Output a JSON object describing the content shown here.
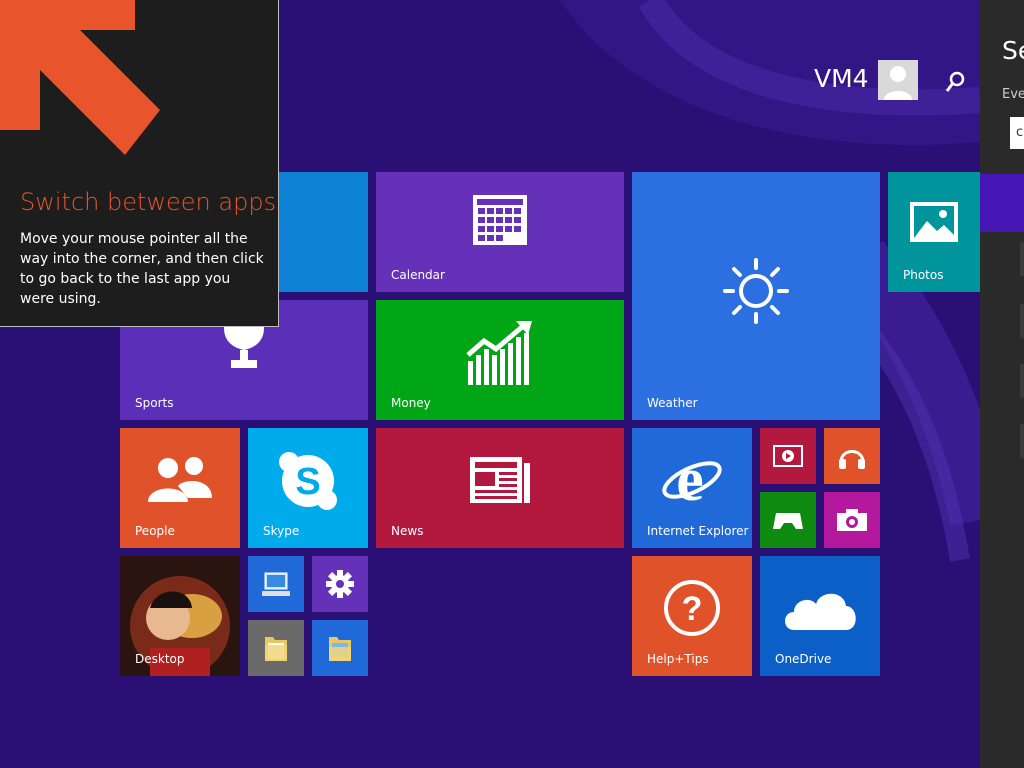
{
  "user": {
    "name": "VM4"
  },
  "search_charm": {
    "title": "Se",
    "scope": "Eve",
    "query": "c"
  },
  "tooltip": {
    "title": "Switch between apps",
    "body": "Move your mouse pointer all the way into the corner, and then click to go back to the last app you were using."
  },
  "tiles": {
    "calendar": "Calendar",
    "photos": "Photos",
    "sports": "Sports",
    "money": "Money",
    "weather": "Weather",
    "people": "People",
    "skype": "Skype",
    "news": "News",
    "internet_explorer": "Internet Explorer",
    "desktop": "Desktop",
    "help_tips": "Help+Tips",
    "onedrive": "OneDrive"
  },
  "colors": {
    "background": "#2a0f75",
    "accent_orange": "#e8552c",
    "calendar": "#6431b8",
    "money": "#00a615",
    "weather": "#2b6fe0",
    "people": "#e0522a",
    "skype": "#00abec",
    "news": "#b3183f",
    "ie": "#1f6ad8",
    "photos": "#00959d",
    "onedrive": "#0b5fc7"
  }
}
